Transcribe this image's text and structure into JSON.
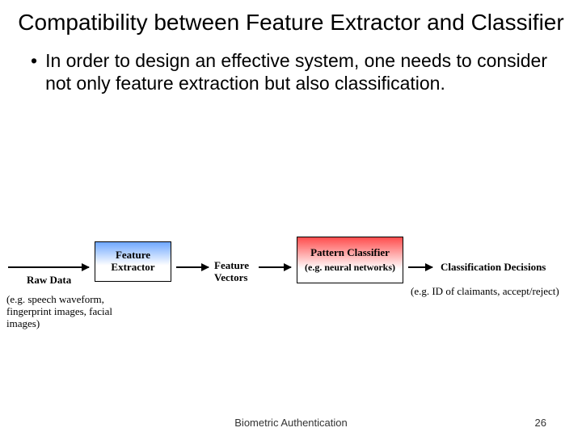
{
  "title": "Compatibility between Feature Extractor and Classifier",
  "bullet": "In order to design an effective system, one needs to consider not only feature extraction but also classification.",
  "diagram": {
    "raw_data_label": "Raw Data",
    "raw_data_sub": "(e.g. speech waveform, fingerprint images, facial images)",
    "feature_extractor_line1": "Feature",
    "feature_extractor_line2": "Extractor",
    "feature_vectors_line1": "Feature",
    "feature_vectors_line2": "Vectors",
    "pattern_classifier": "Pattern Classifier",
    "pattern_classifier_sub": "(e.g. neural networks)",
    "decisions_label": "Classification Decisions",
    "decisions_sub": "(e.g. ID of claimants, accept/reject)"
  },
  "footer": {
    "title": "Biometric Authentication",
    "page": "26"
  }
}
